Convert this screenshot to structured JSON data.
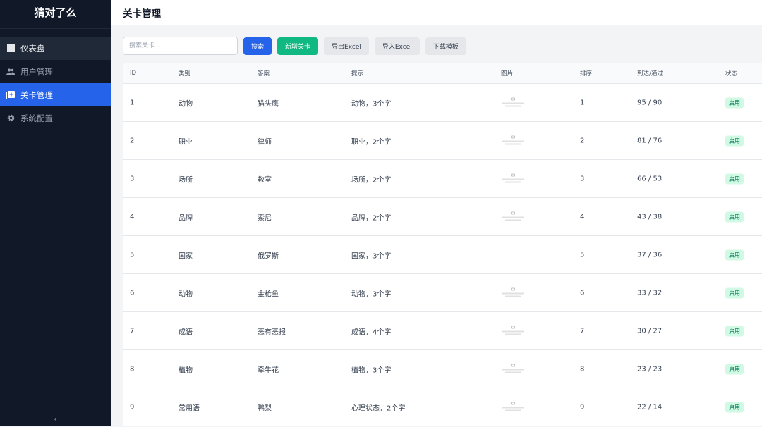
{
  "app": {
    "title": "猜对了么"
  },
  "sidebar": {
    "items": [
      {
        "label": "仪表盘",
        "icon": "dashboard-icon"
      },
      {
        "label": "用户管理",
        "icon": "users-icon"
      },
      {
        "label": "关卡管理",
        "icon": "add-box-icon"
      },
      {
        "label": "系统配置",
        "icon": "gear-icon"
      }
    ],
    "collapse": "‹"
  },
  "header": {
    "title": "关卡管理"
  },
  "toolbar": {
    "search_placeholder": "搜索关卡...",
    "search": "搜索",
    "add": "新增关卡",
    "export": "导出Excel",
    "import": "导入Excel",
    "template": "下载模板"
  },
  "table": {
    "headers": [
      "ID",
      "类别",
      "答案",
      "提示",
      "图片",
      "排序",
      "到达/通过",
      "状态"
    ],
    "rows": [
      {
        "id": "1",
        "cat": "动物",
        "ans": "猫头鹰",
        "hint": "动物，3个字",
        "img": true,
        "order": "1",
        "stats": "95 / 90",
        "status": "启用"
      },
      {
        "id": "2",
        "cat": "职业",
        "ans": "律师",
        "hint": "职业，2个字",
        "img": true,
        "order": "2",
        "stats": "81 / 76",
        "status": "启用"
      },
      {
        "id": "3",
        "cat": "场所",
        "ans": "教室",
        "hint": "场所，2个字",
        "img": true,
        "order": "3",
        "stats": "66 / 53",
        "status": "启用"
      },
      {
        "id": "4",
        "cat": "品牌",
        "ans": "索尼",
        "hint": "品牌，2个字",
        "img": true,
        "order": "4",
        "stats": "43 / 38",
        "status": "启用"
      },
      {
        "id": "5",
        "cat": "国家",
        "ans": "俄罗斯",
        "hint": "国家，3个字",
        "img": false,
        "order": "5",
        "stats": "37 / 36",
        "status": "启用"
      },
      {
        "id": "6",
        "cat": "动物",
        "ans": "金枪鱼",
        "hint": "动物，3个字",
        "img": true,
        "order": "6",
        "stats": "33 / 32",
        "status": "启用"
      },
      {
        "id": "7",
        "cat": "成语",
        "ans": "恶有恶报",
        "hint": "成语，4个字",
        "img": true,
        "order": "7",
        "stats": "30 / 27",
        "status": "启用"
      },
      {
        "id": "8",
        "cat": "植物",
        "ans": "牵牛花",
        "hint": "植物，3个字",
        "img": true,
        "order": "8",
        "stats": "23 / 23",
        "status": "启用"
      },
      {
        "id": "9",
        "cat": "常用语",
        "ans": "鸭梨",
        "hint": "心理状态，2个字",
        "img": true,
        "order": "9",
        "stats": "22 / 14",
        "status": "启用"
      }
    ]
  }
}
